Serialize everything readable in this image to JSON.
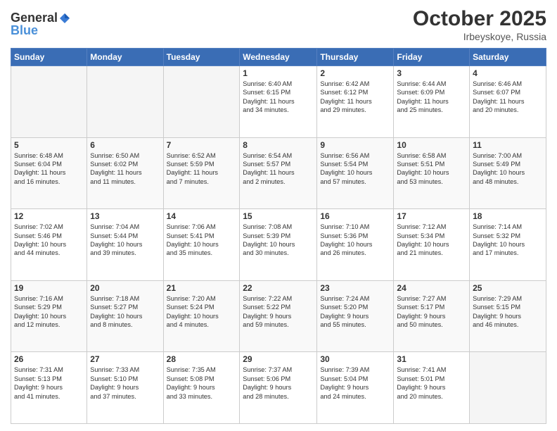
{
  "header": {
    "logo_line1": "General",
    "logo_line2": "Blue",
    "month": "October 2025",
    "location": "Irbeyskoye, Russia"
  },
  "weekdays": [
    "Sunday",
    "Monday",
    "Tuesday",
    "Wednesday",
    "Thursday",
    "Friday",
    "Saturday"
  ],
  "weeks": [
    [
      {
        "day": "",
        "text": ""
      },
      {
        "day": "",
        "text": ""
      },
      {
        "day": "",
        "text": ""
      },
      {
        "day": "1",
        "text": "Sunrise: 6:40 AM\nSunset: 6:15 PM\nDaylight: 11 hours\nand 34 minutes."
      },
      {
        "day": "2",
        "text": "Sunrise: 6:42 AM\nSunset: 6:12 PM\nDaylight: 11 hours\nand 29 minutes."
      },
      {
        "day": "3",
        "text": "Sunrise: 6:44 AM\nSunset: 6:09 PM\nDaylight: 11 hours\nand 25 minutes."
      },
      {
        "day": "4",
        "text": "Sunrise: 6:46 AM\nSunset: 6:07 PM\nDaylight: 11 hours\nand 20 minutes."
      }
    ],
    [
      {
        "day": "5",
        "text": "Sunrise: 6:48 AM\nSunset: 6:04 PM\nDaylight: 11 hours\nand 16 minutes."
      },
      {
        "day": "6",
        "text": "Sunrise: 6:50 AM\nSunset: 6:02 PM\nDaylight: 11 hours\nand 11 minutes."
      },
      {
        "day": "7",
        "text": "Sunrise: 6:52 AM\nSunset: 5:59 PM\nDaylight: 11 hours\nand 7 minutes."
      },
      {
        "day": "8",
        "text": "Sunrise: 6:54 AM\nSunset: 5:57 PM\nDaylight: 11 hours\nand 2 minutes."
      },
      {
        "day": "9",
        "text": "Sunrise: 6:56 AM\nSunset: 5:54 PM\nDaylight: 10 hours\nand 57 minutes."
      },
      {
        "day": "10",
        "text": "Sunrise: 6:58 AM\nSunset: 5:51 PM\nDaylight: 10 hours\nand 53 minutes."
      },
      {
        "day": "11",
        "text": "Sunrise: 7:00 AM\nSunset: 5:49 PM\nDaylight: 10 hours\nand 48 minutes."
      }
    ],
    [
      {
        "day": "12",
        "text": "Sunrise: 7:02 AM\nSunset: 5:46 PM\nDaylight: 10 hours\nand 44 minutes."
      },
      {
        "day": "13",
        "text": "Sunrise: 7:04 AM\nSunset: 5:44 PM\nDaylight: 10 hours\nand 39 minutes."
      },
      {
        "day": "14",
        "text": "Sunrise: 7:06 AM\nSunset: 5:41 PM\nDaylight: 10 hours\nand 35 minutes."
      },
      {
        "day": "15",
        "text": "Sunrise: 7:08 AM\nSunset: 5:39 PM\nDaylight: 10 hours\nand 30 minutes."
      },
      {
        "day": "16",
        "text": "Sunrise: 7:10 AM\nSunset: 5:36 PM\nDaylight: 10 hours\nand 26 minutes."
      },
      {
        "day": "17",
        "text": "Sunrise: 7:12 AM\nSunset: 5:34 PM\nDaylight: 10 hours\nand 21 minutes."
      },
      {
        "day": "18",
        "text": "Sunrise: 7:14 AM\nSunset: 5:32 PM\nDaylight: 10 hours\nand 17 minutes."
      }
    ],
    [
      {
        "day": "19",
        "text": "Sunrise: 7:16 AM\nSunset: 5:29 PM\nDaylight: 10 hours\nand 12 minutes."
      },
      {
        "day": "20",
        "text": "Sunrise: 7:18 AM\nSunset: 5:27 PM\nDaylight: 10 hours\nand 8 minutes."
      },
      {
        "day": "21",
        "text": "Sunrise: 7:20 AM\nSunset: 5:24 PM\nDaylight: 10 hours\nand 4 minutes."
      },
      {
        "day": "22",
        "text": "Sunrise: 7:22 AM\nSunset: 5:22 PM\nDaylight: 9 hours\nand 59 minutes."
      },
      {
        "day": "23",
        "text": "Sunrise: 7:24 AM\nSunset: 5:20 PM\nDaylight: 9 hours\nand 55 minutes."
      },
      {
        "day": "24",
        "text": "Sunrise: 7:27 AM\nSunset: 5:17 PM\nDaylight: 9 hours\nand 50 minutes."
      },
      {
        "day": "25",
        "text": "Sunrise: 7:29 AM\nSunset: 5:15 PM\nDaylight: 9 hours\nand 46 minutes."
      }
    ],
    [
      {
        "day": "26",
        "text": "Sunrise: 7:31 AM\nSunset: 5:13 PM\nDaylight: 9 hours\nand 41 minutes."
      },
      {
        "day": "27",
        "text": "Sunrise: 7:33 AM\nSunset: 5:10 PM\nDaylight: 9 hours\nand 37 minutes."
      },
      {
        "day": "28",
        "text": "Sunrise: 7:35 AM\nSunset: 5:08 PM\nDaylight: 9 hours\nand 33 minutes."
      },
      {
        "day": "29",
        "text": "Sunrise: 7:37 AM\nSunset: 5:06 PM\nDaylight: 9 hours\nand 28 minutes."
      },
      {
        "day": "30",
        "text": "Sunrise: 7:39 AM\nSunset: 5:04 PM\nDaylight: 9 hours\nand 24 minutes."
      },
      {
        "day": "31",
        "text": "Sunrise: 7:41 AM\nSunset: 5:01 PM\nDaylight: 9 hours\nand 20 minutes."
      },
      {
        "day": "",
        "text": ""
      }
    ]
  ]
}
